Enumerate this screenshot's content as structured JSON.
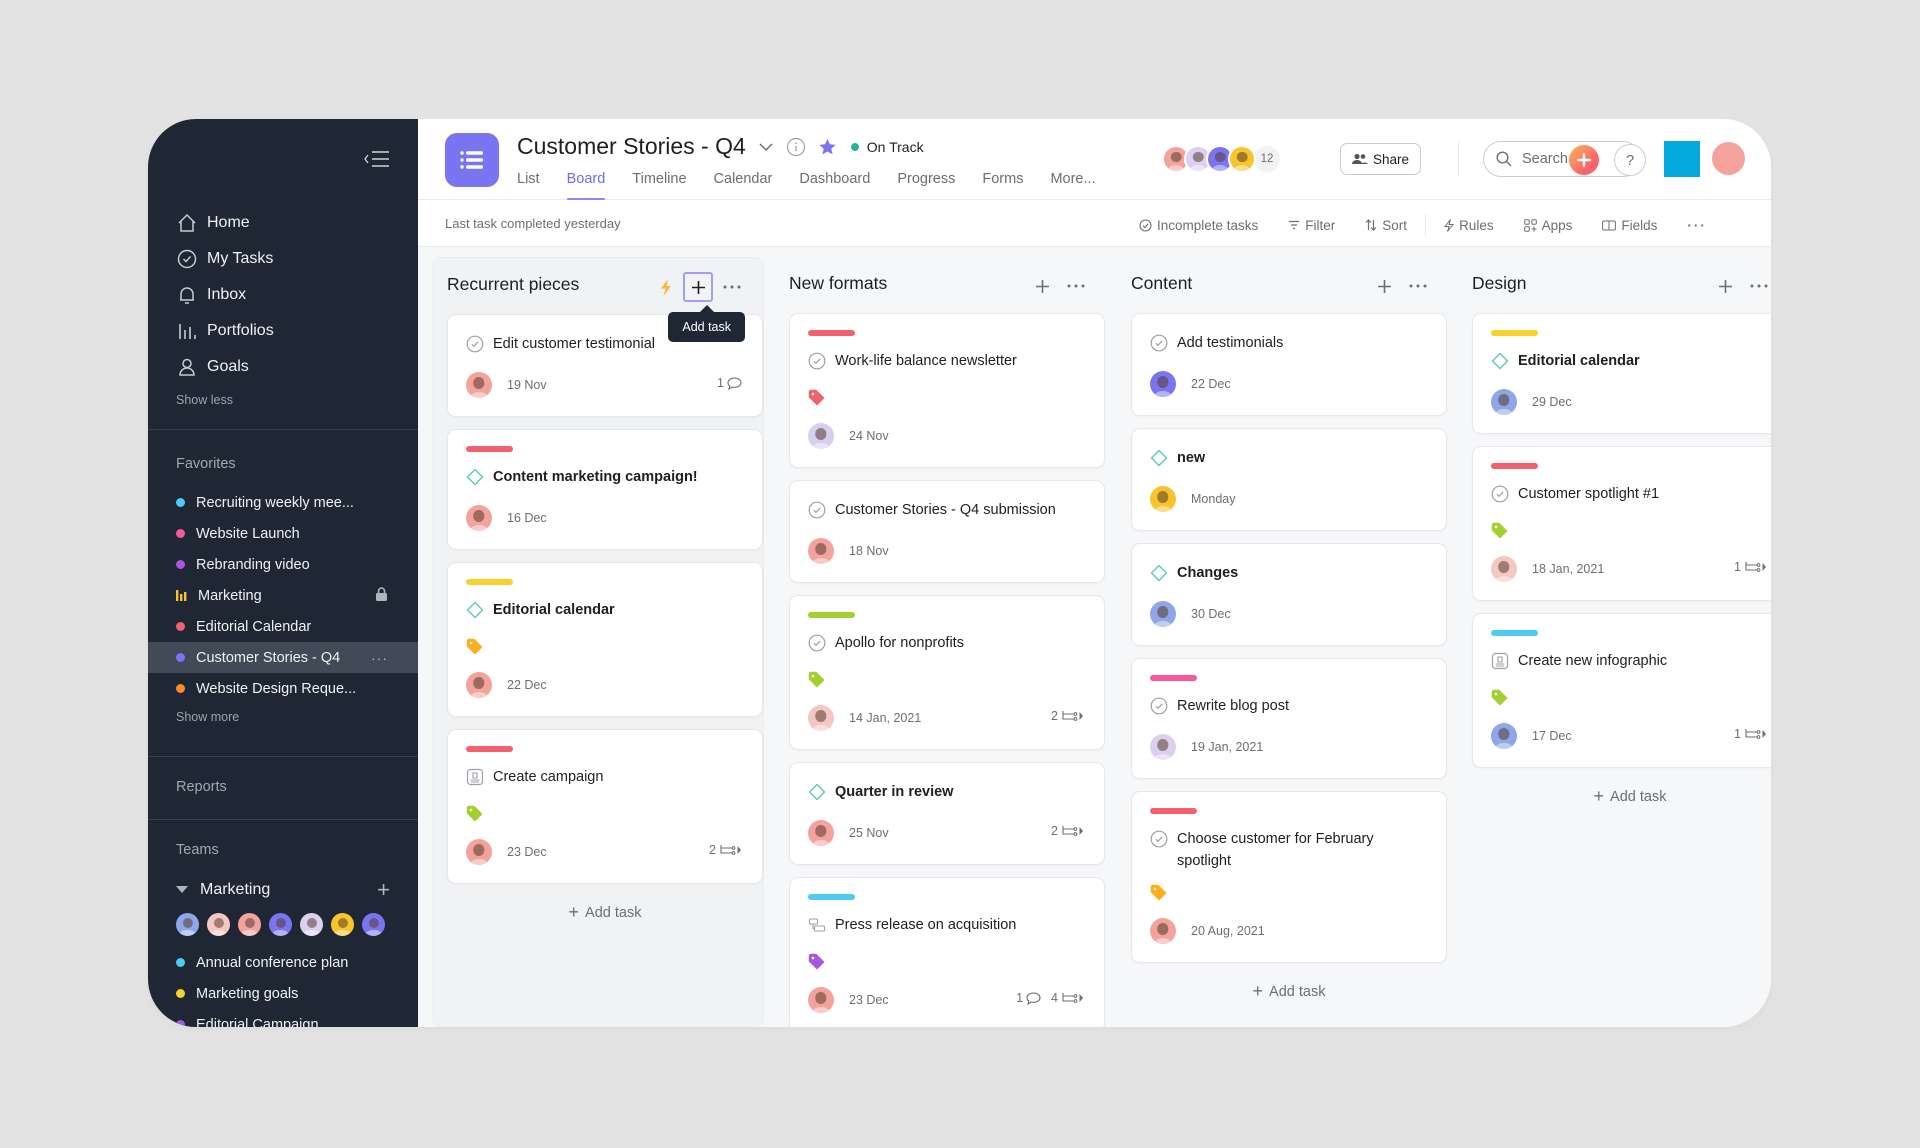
{
  "sidebar": {
    "nav": [
      {
        "label": "Home",
        "icon": "home-icon"
      },
      {
        "label": "My Tasks",
        "icon": "check-circle-icon"
      },
      {
        "label": "Inbox",
        "icon": "bell-icon"
      },
      {
        "label": "Portfolios",
        "icon": "bar-chart-icon"
      },
      {
        "label": "Goals",
        "icon": "person-icon"
      }
    ],
    "show_less": "Show less",
    "favorites_heading": "Favorites",
    "favorites": [
      {
        "label": "Recruiting weekly mee...",
        "color": "#4ecbf3"
      },
      {
        "label": "Website Launch",
        "color": "#f9589c"
      },
      {
        "label": "Rebranding video",
        "color": "#a659e0"
      },
      {
        "label": "Marketing",
        "color": "#f8c42c",
        "icon": "portfolio-bars-icon",
        "locked": true
      },
      {
        "label": "Editorial Calendar",
        "color": "#f5606f"
      },
      {
        "label": "Customer Stories - Q4",
        "color": "#7b74f1",
        "active": true
      },
      {
        "label": "Website Design Reque...",
        "color": "#fd8a2a"
      }
    ],
    "show_more": "Show more",
    "reports_heading": "Reports",
    "teams_heading": "Teams",
    "team": {
      "name": "Marketing",
      "member_colors": [
        "#8fa6e8",
        "#f4c7c2",
        "#f3a39c",
        "#7b74f1",
        "#dcd0f0",
        "#f8c42c",
        "#7b74f1"
      ],
      "projects": [
        {
          "label": "Annual conference plan",
          "color": "#4ecbf3"
        },
        {
          "label": "Marketing goals",
          "color": "#f8d12c"
        },
        {
          "label": "Editorial Campaign",
          "color": "#a659e0"
        }
      ]
    }
  },
  "header": {
    "project_title": "Customer Stories - Q4",
    "status": "On Track",
    "status_color": "#2bb396",
    "tabs": [
      {
        "label": "List",
        "active": false
      },
      {
        "label": "Board",
        "active": true
      },
      {
        "label": "Timeline",
        "active": false
      },
      {
        "label": "Calendar",
        "active": false
      },
      {
        "label": "Dashboard",
        "active": false
      },
      {
        "label": "Progress",
        "active": false
      },
      {
        "label": "Forms",
        "active": false
      },
      {
        "label": "More...",
        "active": false
      }
    ],
    "member_colors": [
      "#f3a39c",
      "#dcd0f0",
      "#7b74f1",
      "#f8c42c"
    ],
    "member_count": "12",
    "share_label": "Share",
    "search_placeholder": "Search",
    "help_label": "?",
    "org_color": "#04a9e0"
  },
  "subbar": {
    "last_completed": "Last task completed yesterday",
    "actions": {
      "incomplete": "Incomplete tasks",
      "filter": "Filter",
      "sort": "Sort",
      "rules": "Rules",
      "apps": "Apps",
      "fields": "Fields"
    }
  },
  "board": {
    "tooltip": "Add task",
    "add_task_label": "Add task",
    "columns": [
      {
        "title": "Recurrent pieces",
        "cards": [
          {
            "title": "Edit customer testimonial",
            "type": "task",
            "bar": null,
            "tag": null,
            "avatar": "#f3a39c",
            "date": "19 Nov",
            "comments": "1",
            "subtasks": null
          },
          {
            "title": "Content marketing campaign!",
            "type": "milestone",
            "bar": "#f5606f",
            "tag": null,
            "avatar": "#f3a39c",
            "date": "16 Dec",
            "comments": null,
            "subtasks": null
          },
          {
            "title": "Editorial calendar",
            "type": "milestone",
            "bar": "#f8d12c",
            "tag": "#fdae1a",
            "avatar": "#f3a39c",
            "date": "22 Dec",
            "comments": null,
            "subtasks": null
          },
          {
            "title": "Create campaign",
            "type": "approval",
            "bar": "#f5606f",
            "tag": "#a4cf30",
            "avatar": "#f3a39c",
            "date": "23 Dec",
            "comments": null,
            "subtasks": "2"
          }
        ]
      },
      {
        "title": "New formats",
        "cards": [
          {
            "title": "Work-life balance newsletter",
            "type": "task",
            "bar": "#f5606f",
            "tag": "#f5606f",
            "avatar": "#d6cff0",
            "date": "24 Nov",
            "comments": null,
            "subtasks": null
          },
          {
            "title": "Customer Stories - Q4 submission",
            "type": "task",
            "bar": null,
            "tag": null,
            "avatar": "#f3a39c",
            "date": "18 Nov",
            "comments": null,
            "subtasks": null
          },
          {
            "title": "Apollo for nonprofits",
            "type": "task",
            "bar": "#a4cf30",
            "tag": "#a4cf30",
            "avatar": "#f4c7c2",
            "date": "14 Jan, 2021",
            "comments": null,
            "subtasks": "2"
          },
          {
            "title": "Quarter in review",
            "type": "milestone",
            "bar": null,
            "tag": null,
            "avatar": "#f3a39c",
            "date": "25 Nov",
            "comments": null,
            "subtasks": "2"
          },
          {
            "title": "Press release on acquisition",
            "type": "dependency",
            "bar": "#4ecbf3",
            "tag": "#a659e0",
            "avatar": "#f3a39c",
            "date": "23 Dec",
            "comments": "1",
            "subtasks": "4"
          }
        ]
      },
      {
        "title": "Content",
        "cards": [
          {
            "title": "Add testimonials",
            "type": "task",
            "bar": null,
            "tag": null,
            "avatar": "#7b74f1",
            "date": "22 Dec",
            "comments": null,
            "subtasks": null
          },
          {
            "title": "new",
            "type": "milestone",
            "bar": null,
            "tag": null,
            "avatar": "#f8c42c",
            "date": "Monday",
            "comments": null,
            "subtasks": null
          },
          {
            "title": "Changes",
            "type": "milestone",
            "bar": null,
            "tag": null,
            "avatar": "#8fa6e8",
            "date": "30 Dec",
            "comments": null,
            "subtasks": null
          },
          {
            "title": "Rewrite blog post",
            "type": "task",
            "bar": "#f9589c",
            "tag": null,
            "avatar": "#dcd0f0",
            "date": "19 Jan, 2021",
            "comments": null,
            "subtasks": null
          },
          {
            "title": "Choose customer for February spotlight",
            "type": "task",
            "bar": "#f5606f",
            "tag": "#fdae1a",
            "avatar": "#f3a39c",
            "date": "20 Aug, 2021",
            "comments": null,
            "subtasks": null
          }
        ]
      },
      {
        "title": "Design",
        "cards": [
          {
            "title": "Editorial calendar",
            "type": "milestone",
            "bar": "#f8d12c",
            "tag": null,
            "avatar": "#8fa6e8",
            "date": "29 Dec",
            "comments": null,
            "subtasks": null
          },
          {
            "title": "Customer spotlight #1",
            "type": "task",
            "bar": "#f5606f",
            "tag": "#a4cf30",
            "avatar": "#f4c7c2",
            "date": "18 Jan, 2021",
            "comments": null,
            "subtasks": "1"
          },
          {
            "title": "Create new infographic",
            "type": "approval",
            "bar": "#4ecbf3",
            "tag": "#a4cf30",
            "avatar": "#8fa6e8",
            "date": "17 Dec",
            "comments": null,
            "subtasks": "1"
          }
        ]
      }
    ]
  }
}
